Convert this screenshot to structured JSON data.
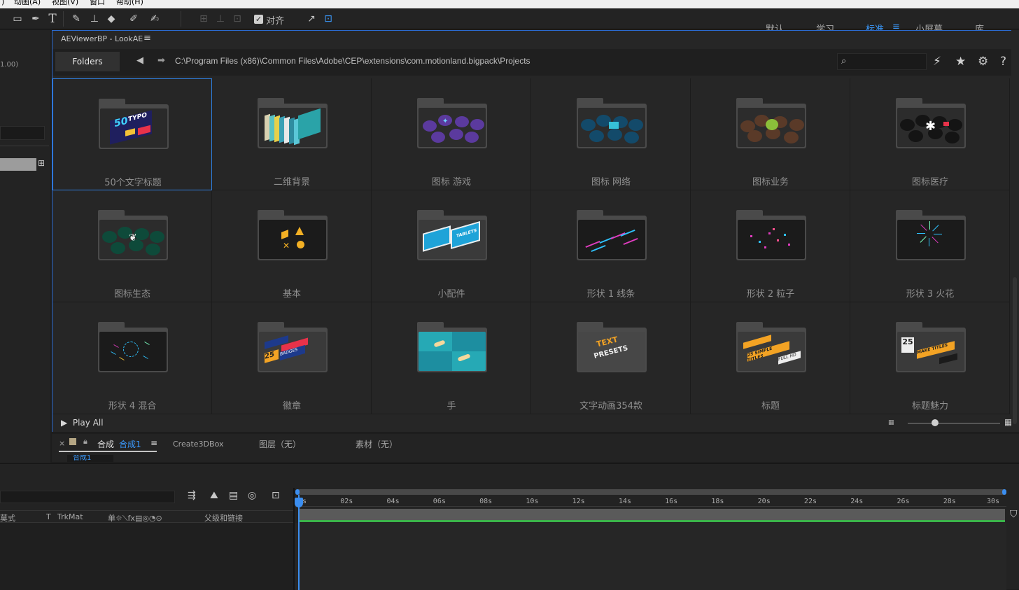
{
  "menubar": {
    "items": [
      ")",
      "动画(A)",
      "视图(V)",
      "窗口",
      "帮助(H)"
    ]
  },
  "toolbar": {
    "icons": [
      "rectangle-tool-icon",
      "pen-tool-icon",
      "type-tool-icon",
      "brush-tool-icon",
      "clone-stamp-icon",
      "eraser-icon",
      "roto-brush-icon",
      "puppet-pin-icon"
    ],
    "align_label": "对齐",
    "workspaces": [
      "默认",
      "学习",
      "标准",
      "小屏幕",
      "库"
    ],
    "active_workspace": "标准",
    "menu_glyph": "≡"
  },
  "leftpanel": {
    "value": "1.00)"
  },
  "viewer": {
    "title": "AEViewerBP - LookAE",
    "menu_glyph": "≡",
    "folders_button": "Folders",
    "path": "C:\\Program Files (x86)\\Common Files\\Adobe\\CEP\\extensions\\com.motionland.bigpack\\Projects",
    "search_placeholder": "",
    "play_all": "Play All",
    "zoom_level": 0.3,
    "folders": [
      {
        "label": "50个文字标题",
        "theme": "typo"
      },
      {
        "label": "二维背景",
        "theme": "bg2d"
      },
      {
        "label": "图标 游戏",
        "theme": "game"
      },
      {
        "label": "图标 网络",
        "theme": "web"
      },
      {
        "label": "图标业务",
        "theme": "biz"
      },
      {
        "label": "图标医疗",
        "theme": "med"
      },
      {
        "label": "图标生态",
        "theme": "eco"
      },
      {
        "label": "基本",
        "theme": "basic"
      },
      {
        "label": "小配件",
        "theme": "widget"
      },
      {
        "label": "形状 1 线条",
        "theme": "lines"
      },
      {
        "label": "形状 2 粒子",
        "theme": "particles"
      },
      {
        "label": "形状 3 火花",
        "theme": "sparks"
      },
      {
        "label": "形状 4 混合",
        "theme": "mix"
      },
      {
        "label": "徽章",
        "theme": "badges"
      },
      {
        "label": "手",
        "theme": "hands"
      },
      {
        "label": "文字动画354款",
        "theme": "textpresets"
      },
      {
        "label": "标题",
        "theme": "titles"
      },
      {
        "label": "标题魅力",
        "theme": "charm"
      }
    ],
    "art_text": {
      "typo_a": "50",
      "typo_b": "TYPO",
      "basic_glyph": "✕",
      "widget": "TABLETS",
      "textpresets_a": "TEXT",
      "textpresets_b": "PRESETS",
      "titles_a": "25 SIMPLE TITLES",
      "titles_b": "FULL HD",
      "charm_a": "25",
      "charm_b": "MAKE TITLES",
      "badges_a": "25",
      "badges_b": "BADGES"
    },
    "selected_index": 0
  },
  "comptabs": {
    "close": "×",
    "comp_prefix": "合成",
    "comp_name": "合成1",
    "menu_glyph": "≡",
    "tab2": "Create3DBox",
    "tab3": "图层（无）",
    "tab4": "素材（无）",
    "sub_label": "合成1"
  },
  "timeline": {
    "header": {
      "mode": "莫式",
      "t": "T",
      "trkmat": "TrkMat",
      "switches": "单☼⟍fx▤◎◔⊙",
      "parent": "父级和链接"
    },
    "ticks": [
      "0s",
      "02s",
      "04s",
      "06s",
      "08s",
      "10s",
      "12s",
      "14s",
      "16s",
      "18s",
      "20s",
      "22s",
      "24s",
      "26s",
      "28s",
      "30s"
    ],
    "duration_s": 30,
    "playhead_s": 0
  },
  "colors": {
    "accent": "#3b9bff",
    "selection": "#2f7fe0",
    "green": "#3bb34a"
  }
}
